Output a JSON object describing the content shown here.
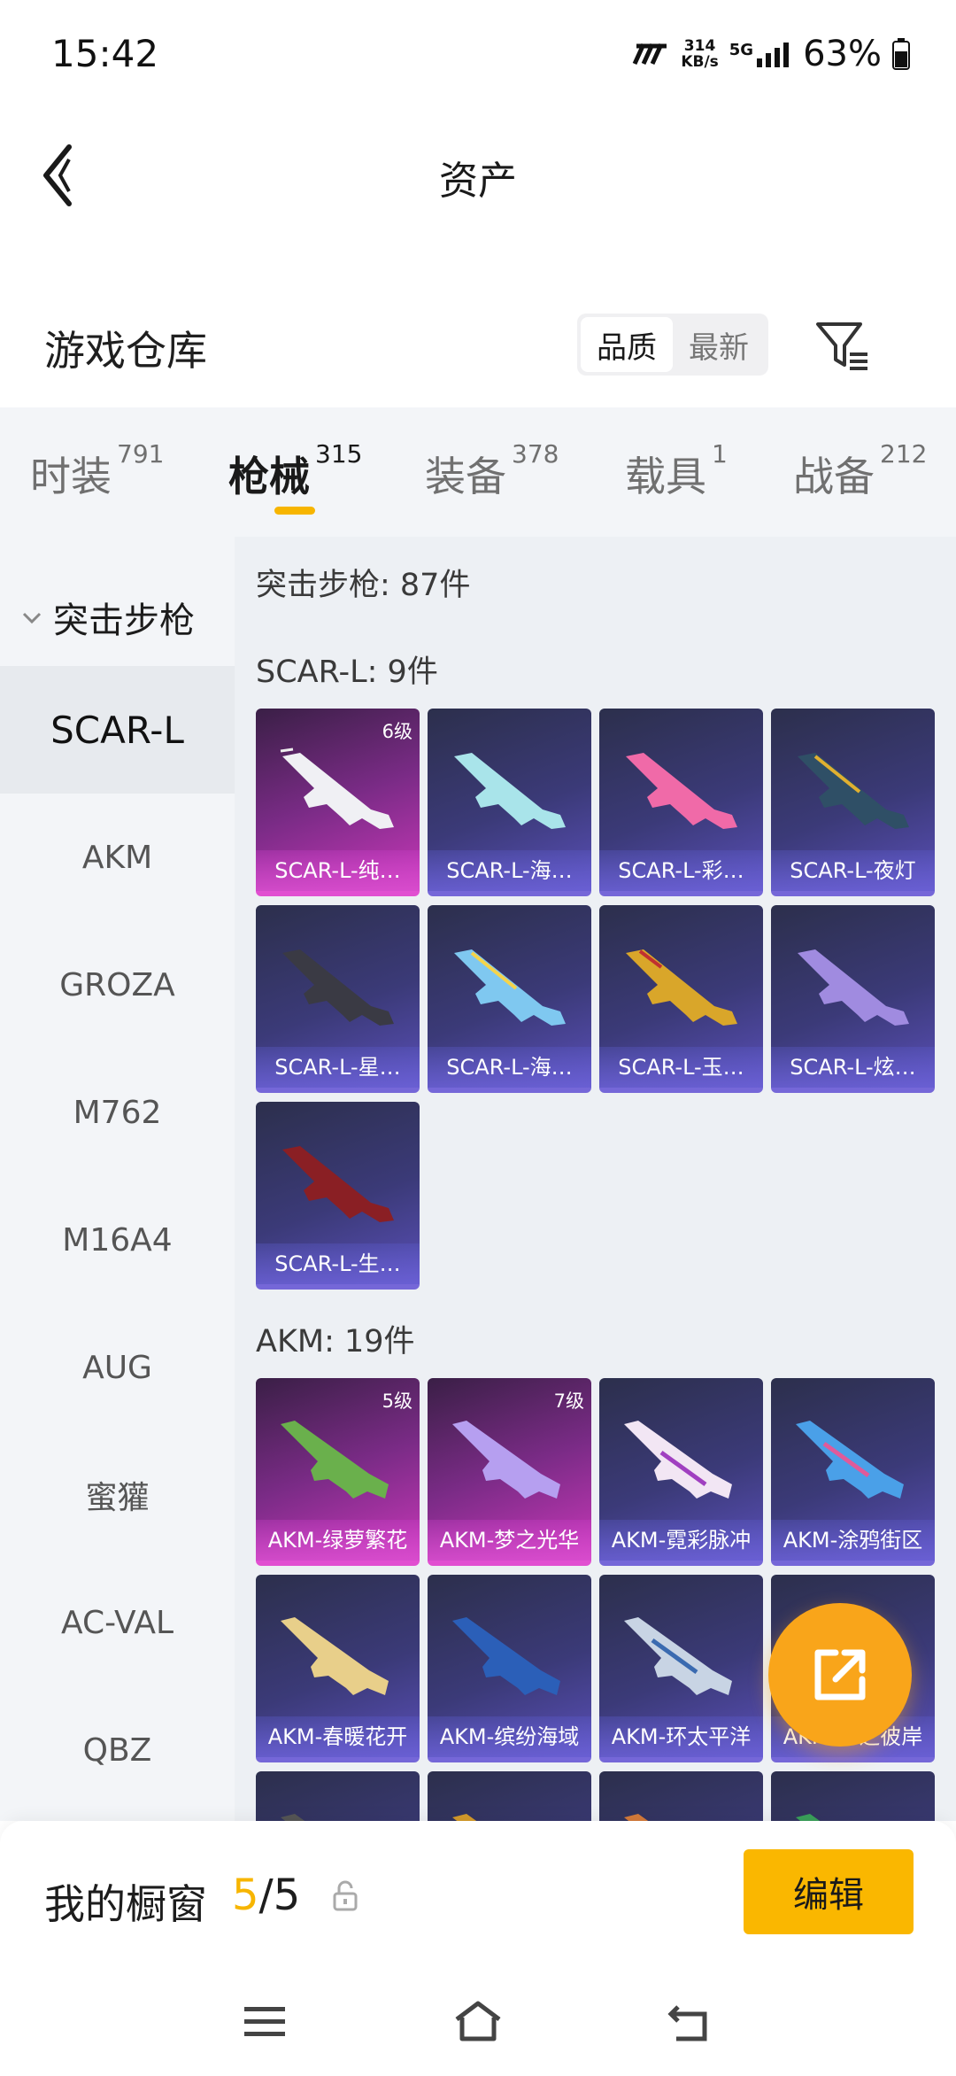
{
  "status_bar": {
    "time": "15:42",
    "net_speed_value": "314",
    "net_speed_unit": "KB/s",
    "network": "5G",
    "battery": "63%"
  },
  "header": {
    "title": "资产"
  },
  "warehouse": {
    "title": "游戏仓库",
    "sort_options": [
      "品质",
      "最新"
    ],
    "active_sort": "品质"
  },
  "category_tabs": [
    {
      "label": "时装",
      "count": "791",
      "active": false
    },
    {
      "label": "枪械",
      "count": "315",
      "active": true
    },
    {
      "label": "装备",
      "count": "378",
      "active": false
    },
    {
      "label": "载具",
      "count": "1",
      "active": false
    },
    {
      "label": "战备",
      "count": "212",
      "active": false
    }
  ],
  "sidebar": {
    "group": "突击步枪",
    "items": [
      "SCAR-L",
      "AKM",
      "GROZA",
      "M762",
      "M16A4",
      "AUG",
      "蜜獾",
      "AC-VAL",
      "QBZ"
    ],
    "active": "SCAR-L"
  },
  "main": {
    "summary": "突击步枪: 87件",
    "sections": [
      {
        "title": "SCAR-L: 9件",
        "items": [
          {
            "name": "SCAR-L-纯…",
            "level": "6级",
            "rarity": "pink"
          },
          {
            "name": "SCAR-L-海…",
            "level": "",
            "rarity": "purple"
          },
          {
            "name": "SCAR-L-彩…",
            "level": "",
            "rarity": "purple"
          },
          {
            "name": "SCAR-L-夜灯",
            "level": "",
            "rarity": "purple"
          },
          {
            "name": "SCAR-L-星…",
            "level": "",
            "rarity": "purple"
          },
          {
            "name": "SCAR-L-海…",
            "level": "",
            "rarity": "purple"
          },
          {
            "name": "SCAR-L-玉…",
            "level": "",
            "rarity": "purple"
          },
          {
            "name": "SCAR-L-炫…",
            "level": "",
            "rarity": "purple"
          },
          {
            "name": "SCAR-L-生…",
            "level": "",
            "rarity": "purple"
          }
        ]
      },
      {
        "title": "AKM: 19件",
        "items": [
          {
            "name": "AKM-绿萝繁花",
            "level": "5级",
            "rarity": "pink"
          },
          {
            "name": "AKM-梦之光华",
            "level": "7级",
            "rarity": "pink"
          },
          {
            "name": "AKM-霓彩脉冲",
            "level": "",
            "rarity": "purple"
          },
          {
            "name": "AKM-涂鸦街区",
            "level": "",
            "rarity": "purple"
          },
          {
            "name": "AKM-春暖花开",
            "level": "",
            "rarity": "purple"
          },
          {
            "name": "AKM-缤纷海域",
            "level": "",
            "rarity": "purple"
          },
          {
            "name": "AKM-环太平洋",
            "level": "",
            "rarity": "purple"
          },
          {
            "name": "AKM-…之彼岸",
            "level": "",
            "rarity": "purple"
          },
          {
            "name": "",
            "level": "",
            "rarity": "purple"
          },
          {
            "name": "",
            "level": "",
            "rarity": "purple"
          },
          {
            "name": "",
            "level": "",
            "rarity": "purple"
          },
          {
            "name": "",
            "level": "",
            "rarity": "purple"
          }
        ]
      }
    ]
  },
  "showcase": {
    "label": "我的橱窗",
    "current": "5",
    "total": "/5",
    "edit_label": "编辑"
  },
  "colors": {
    "accent": "#fab700",
    "fab": "#f9a51a",
    "pink_rarity": "#e14fd1",
    "purple_rarity": "#7567d8"
  },
  "icons": {
    "back": "chevron-left-icon",
    "filter": "filter-icon",
    "share": "share-external-icon",
    "lock": "lock-icon",
    "nav": [
      "menu-icon",
      "home-icon",
      "back-nav-icon"
    ]
  }
}
